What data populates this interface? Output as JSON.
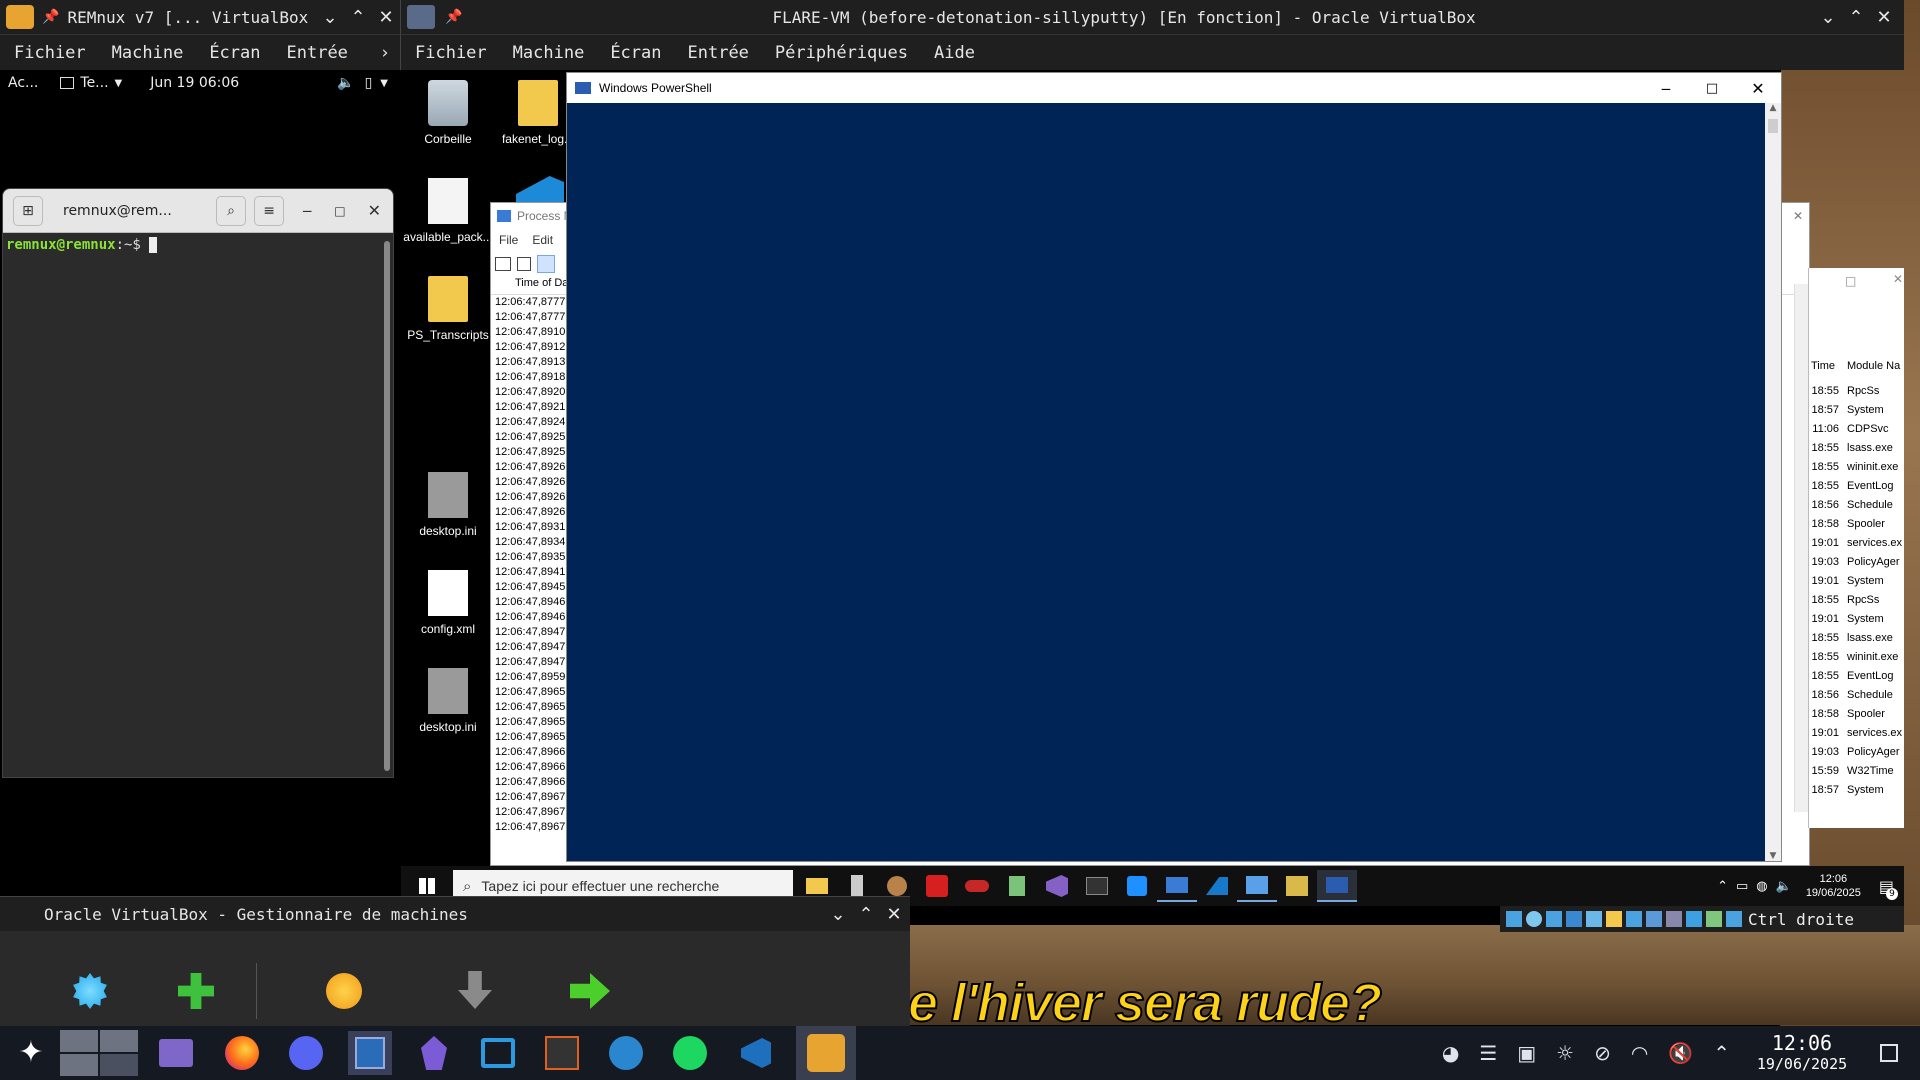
{
  "remnux_vm": {
    "title": "REMnux v7 [... VirtualBox",
    "menu": [
      "Fichier",
      "Machine",
      "Écran",
      "Entrée"
    ],
    "gnome_bar": {
      "activities": "Ac...",
      "app": "Te...",
      "datetime": "Jun 19  06:06"
    },
    "terminal": {
      "title": "remnux@rem...",
      "prompt_user": "remnux@remnux",
      "prompt_path": ":~$"
    }
  },
  "flare_vm": {
    "title": "FLARE-VM (before-detonation-sillyputty) [En fonction] - Oracle VirtualBox",
    "menu": [
      "Fichier",
      "Machine",
      "Écran",
      "Entrée",
      "Périphériques",
      "Aide"
    ],
    "desktop_icons": [
      "Corbeille",
      "fakenet_log...",
      "available_pack...",
      "PS_Transcripts",
      "desktop.ini",
      "config.xml",
      "desktop.ini"
    ],
    "powershell": {
      "title": "Windows PowerShell"
    },
    "procmon": {
      "title": "Process M",
      "menu": [
        "File",
        "Edit"
      ],
      "column": "Time of Da",
      "rows": [
        "12:06:47,8777",
        "12:06:47,8777",
        "12:06:47,8910",
        "12:06:47,8912",
        "12:06:47,8913",
        "12:06:47,8918",
        "12:06:47,8920",
        "12:06:47,8921",
        "12:06:47,8924",
        "12:06:47,8925",
        "12:06:47,8925",
        "12:06:47,8926",
        "12:06:47,8926",
        "12:06:47,8926",
        "12:06:47,8926",
        "12:06:47,8931",
        "12:06:47,8934",
        "12:06:47,8935",
        "12:06:47,8941",
        "12:06:47,8945",
        "12:06:47,8946",
        "12:06:47,8946",
        "12:06:47,8947",
        "12:06:47,8947",
        "12:06:47,8947",
        "12:06:47,8959",
        "12:06:47,8965",
        "12:06:47,8965",
        "12:06:47,8965",
        "12:06:47,8965",
        "12:06:47,8966",
        "12:06:47,8966",
        "12:06:47,8966",
        "12:06:47,8967",
        "12:06:47,8967",
        "12:06:47,8967"
      ]
    },
    "right_table": {
      "headers": [
        "Time",
        "Module Na"
      ],
      "rows": [
        [
          "18:55",
          "RpcSs"
        ],
        [
          "18:57",
          "System"
        ],
        [
          "11:06",
          "CDPSvc"
        ],
        [
          "18:55",
          "lsass.exe"
        ],
        [
          "18:55",
          "wininit.exe"
        ],
        [
          "18:55",
          "EventLog"
        ],
        [
          "18:56",
          "Schedule"
        ],
        [
          "18:58",
          "Spooler"
        ],
        [
          "19:01",
          "services.ex"
        ],
        [
          "19:03",
          "PolicyAger"
        ],
        [
          "19:01",
          "System"
        ],
        [
          "18:55",
          "RpcSs"
        ],
        [
          "19:01",
          "System"
        ],
        [
          "18:55",
          "lsass.exe"
        ],
        [
          "18:55",
          "wininit.exe"
        ],
        [
          "18:55",
          "EventLog"
        ],
        [
          "18:56",
          "Schedule"
        ],
        [
          "18:58",
          "Spooler"
        ],
        [
          "19:01",
          "services.ex"
        ],
        [
          "19:03",
          "PolicyAger"
        ],
        [
          "15:59",
          "W32Time"
        ],
        [
          "18:57",
          "System"
        ]
      ]
    },
    "win_taskbar": {
      "search_placeholder": "Tapez ici pour effectuer une recherche",
      "time": "12:06",
      "date": "19/06/2025",
      "notif_count": "9"
    },
    "vbox_status": {
      "host_key": "Ctrl droite"
    }
  },
  "vbox_manager": {
    "title": "Oracle VirtualBox - Gestionnaire de machines"
  },
  "background": {
    "subtitle": "e l'hiver sera rude?"
  },
  "host_taskbar": {
    "time": "12:06",
    "date": "19/06/2025"
  },
  "colors": {
    "powershell_bg": "#012456",
    "titlebar": "#1f1f1f",
    "prompt_green": "#8ae234"
  }
}
